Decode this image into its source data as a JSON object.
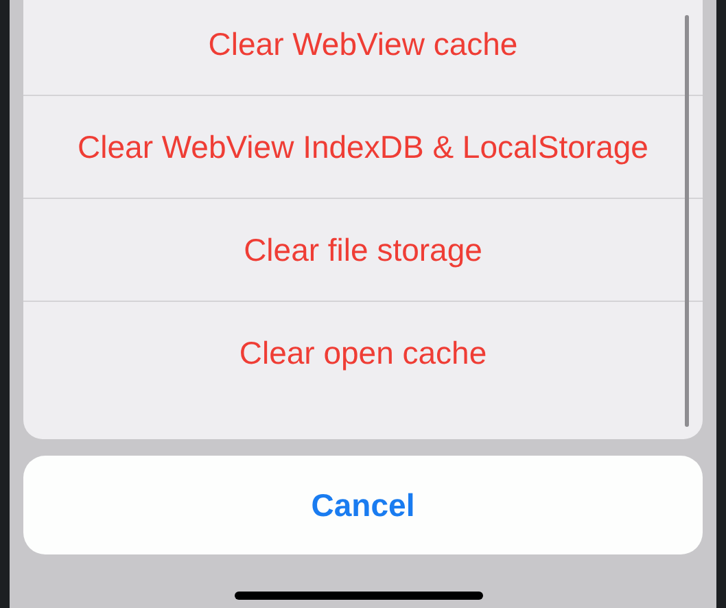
{
  "action_sheet": {
    "actions": [
      {
        "label": "Clear WebView cache"
      },
      {
        "label": "Clear WebView IndexDB & LocalStorage"
      },
      {
        "label": "Clear file storage"
      },
      {
        "label": "Clear open cache"
      }
    ],
    "cancel": {
      "label": "Cancel"
    }
  }
}
